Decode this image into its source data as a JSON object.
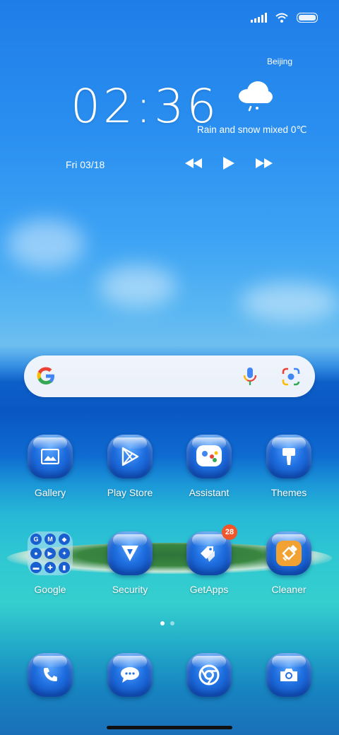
{
  "status_bar": {
    "icons": [
      "signal-icon",
      "wifi-icon",
      "battery-icon"
    ]
  },
  "widget": {
    "time": "02:36",
    "city": "Beijing",
    "weather": "Rain and snow mixed  0℃",
    "weather_icon": "rain-snow-cloud-icon",
    "date": "Fri 03/18",
    "media_controls": [
      "rewind-icon",
      "play-icon",
      "fast-forward-icon"
    ]
  },
  "search": {
    "logo": "google-g-icon",
    "mic": "microphone-icon",
    "lens": "lens-camera-icon"
  },
  "apps_row1": [
    {
      "label": "Gallery",
      "icon": "gallery-icon"
    },
    {
      "label": "Play Store",
      "icon": "play-store-icon"
    },
    {
      "label": "Assistant",
      "icon": "assistant-icon"
    },
    {
      "label": "Themes",
      "icon": "themes-brush-icon"
    }
  ],
  "apps_row2": [
    {
      "label": "Google",
      "icon": "google-folder"
    },
    {
      "label": "Security",
      "icon": "security-icon"
    },
    {
      "label": "GetApps",
      "icon": "getapps-icon",
      "badge": "28"
    },
    {
      "label": "Cleaner",
      "icon": "cleaner-icon"
    }
  ],
  "folder_items": [
    "G",
    "M",
    "◆",
    "●",
    "▶",
    "✦",
    "▬",
    "✚",
    "▮"
  ],
  "page_indicator": {
    "count": 2,
    "active": 0
  },
  "dock": [
    {
      "icon": "phone-icon"
    },
    {
      "icon": "messages-icon"
    },
    {
      "icon": "chrome-icon"
    },
    {
      "icon": "camera-icon"
    }
  ],
  "colors": {
    "badge": "#f0562a",
    "search_bg": "#f6f8fc"
  }
}
